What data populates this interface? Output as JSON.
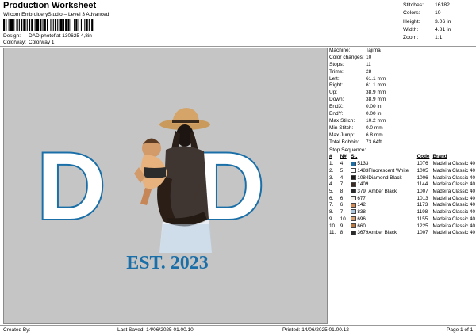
{
  "header": {
    "title": "Production Worksheet",
    "subtitle": "Wilcom EmbroideryStudio – Level 3 Advanced",
    "design_label": "Design:",
    "design_value": "DAD photoflat 130625 4,8in",
    "colorway_label": "Colorway:",
    "colorway_value": "Colorway 1"
  },
  "summary": [
    {
      "label": "Stitches:",
      "value": "16182"
    },
    {
      "label": "Colors:",
      "value": "10"
    },
    {
      "label": "Height:",
      "value": "3.06 in"
    },
    {
      "label": "Width:",
      "value": "4.81 in"
    },
    {
      "label": "Zoom:",
      "value": "1:1"
    }
  ],
  "specs": [
    {
      "label": "Machine:",
      "value": "Tajima"
    },
    {
      "label": "Color changes:",
      "value": "10"
    },
    {
      "label": "Stops:",
      "value": "11"
    },
    {
      "label": "Trims:",
      "value": "28"
    },
    {
      "label": "Left:",
      "value": "61.1 mm"
    },
    {
      "label": "Right:",
      "value": "61.1 mm"
    },
    {
      "label": "Up:",
      "value": "38.9 mm"
    },
    {
      "label": "Down:",
      "value": "38.9 mm"
    },
    {
      "label": "EndX:",
      "value": "0.00 in"
    },
    {
      "label": "EndY:",
      "value": "0.00 in"
    },
    {
      "label": "Max Stitch:",
      "value": "10.2 mm"
    },
    {
      "label": "Min Stitch:",
      "value": "0.0 mm"
    },
    {
      "label": "Max Jump:",
      "value": "6.8 mm"
    },
    {
      "label": "Total Bobbin:",
      "value": "73.64ft"
    }
  ],
  "stop_sequence": {
    "title": "Stop Sequence:",
    "headers": {
      "num": "#",
      "n": "N#",
      "st": "St.",
      "code": "Code",
      "brand": "Brand"
    },
    "rows": [
      {
        "num": "1.",
        "n": "4",
        "color": "#1a6fa8",
        "st": "5133",
        "name": "",
        "code": "1076",
        "brand": "Madeira Classic 40"
      },
      {
        "num": "2.",
        "n": "5",
        "color": "#ffffff",
        "st": "1483",
        "name": "Fluorescent White",
        "code": "1005",
        "brand": "Madeira Classic 40"
      },
      {
        "num": "3.",
        "n": "4",
        "color": "#1b1b1b",
        "st": "1084",
        "name": "Diamond Black",
        "code": "1006",
        "brand": "Madeira Classic 40"
      },
      {
        "num": "4.",
        "n": "7",
        "color": "#3d2a20",
        "st": "1409",
        "name": "",
        "code": "1144",
        "brand": "Madeira Classic 40"
      },
      {
        "num": "5.",
        "n": "8",
        "color": "#2b2b2b",
        "st": "379",
        "name": "Amber Black",
        "code": "1007",
        "brand": "Madeira Classic 40"
      },
      {
        "num": "6.",
        "n": "6",
        "color": "#f3f1ea",
        "st": "677",
        "name": "",
        "code": "1013",
        "brand": "Madeira Classic 40"
      },
      {
        "num": "7.",
        "n": "6",
        "color": "#cf8a55",
        "st": "142",
        "name": "",
        "code": "1173",
        "brand": "Madeira Classic 40"
      },
      {
        "num": "8.",
        "n": "7",
        "color": "#aac7e0",
        "st": "838",
        "name": "",
        "code": "1198",
        "brand": "Madeira Classic 40"
      },
      {
        "num": "9.",
        "n": "10",
        "color": "#d9a070",
        "st": "696",
        "name": "",
        "code": "1155",
        "brand": "Madeira Classic 40"
      },
      {
        "num": "10.",
        "n": "9",
        "color": "#b9763e",
        "st": "660",
        "name": "",
        "code": "1225",
        "brand": "Madeira Classic 40"
      },
      {
        "num": "11.",
        "n": "8",
        "color": "#2b2b2b",
        "st": "3679",
        "name": "Amber Black",
        "code": "1007",
        "brand": "Madeira Classic 40"
      }
    ]
  },
  "design": {
    "letter_left": "D",
    "letter_right": "D",
    "caption": "EST. 2023",
    "accent_color": "#1a6fa8",
    "canvas_color": "#c5c5c5"
  },
  "footer": {
    "created_by": "Created By:",
    "last_saved": "Last Saved: 14/06/2025 01.00.10",
    "printed": "Printed: 14/06/2025 01.00.12",
    "page": "Page 1 of 1"
  }
}
